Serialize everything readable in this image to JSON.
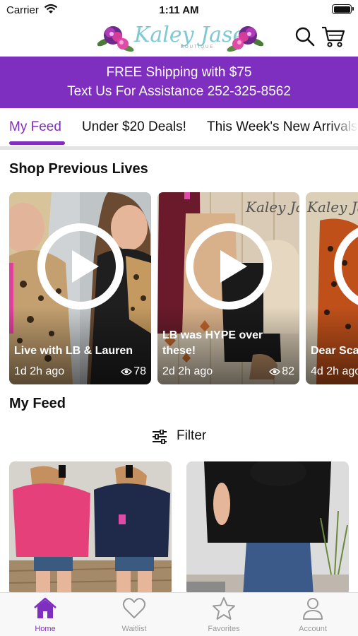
{
  "status_bar": {
    "carrier": "Carrier",
    "time": "1:11 AM"
  },
  "header": {
    "logo_text": "Kaley Jase",
    "logo_subtext": "BOUTIQUE"
  },
  "banner": {
    "line1": "FREE Shipping with $75",
    "line2": "Text Us For Assistance 252-325-8562",
    "color": "#7f2fbf"
  },
  "tabs": [
    {
      "label": "My Feed",
      "active": true
    },
    {
      "label": "Under $20 Deals!",
      "active": false
    },
    {
      "label": "This Week's New Arrivals",
      "active": false
    }
  ],
  "lives_section": {
    "title": "Shop Previous Lives",
    "items": [
      {
        "title": "Live with LB & Lauren",
        "ago": "1d 2h ago",
        "views": "78"
      },
      {
        "title": "LB was HYPE over these!",
        "ago": "2d 2h ago",
        "views": "82"
      },
      {
        "title": "Dear Scarlett Exclusive",
        "ago": "4d 2h ago",
        "views": ""
      }
    ]
  },
  "feed_section": {
    "title": "My Feed",
    "filter_label": "Filter"
  },
  "bottom_nav": [
    {
      "label": "Home",
      "icon": "home-icon",
      "active": true
    },
    {
      "label": "Waitlist",
      "icon": "heart-icon",
      "active": false
    },
    {
      "label": "Favorites",
      "icon": "star-icon",
      "active": false
    },
    {
      "label": "Account",
      "icon": "person-icon",
      "active": false
    }
  ],
  "colors": {
    "accent": "#7f2fbf",
    "inactive": "#999999"
  }
}
